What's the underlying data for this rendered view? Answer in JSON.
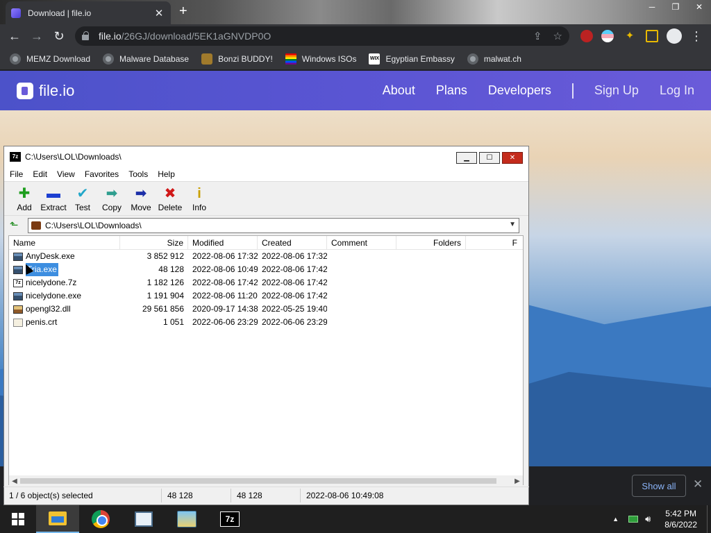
{
  "browser": {
    "tab_title": "Download | file.io",
    "url_host": "file.io",
    "url_path": "/26GJ/download/5EK1aGNVDP0O",
    "ext_badge": "1",
    "bookmarks": [
      {
        "label": "MEMZ Download",
        "icon": "globe-icon"
      },
      {
        "label": "Malware Database",
        "icon": "globe-icon"
      },
      {
        "label": "Bonzi BUDDY!",
        "icon": "bonzi-icon"
      },
      {
        "label": "Windows ISOs",
        "icon": "rainbow-flag-icon"
      },
      {
        "label": "Egyptian Embassy",
        "icon": "wix-icon"
      },
      {
        "label": "malwat.ch",
        "icon": "globe-icon"
      }
    ]
  },
  "site": {
    "logo_text": "file.io",
    "nav": [
      "About",
      "Plans",
      "Developers",
      "Sign Up",
      "Log In"
    ],
    "accent": "#5a55d3"
  },
  "download_bar": {
    "show_all": "Show all"
  },
  "sevenzip": {
    "title": "C:\\Users\\LOL\\Downloads\\",
    "menu": [
      "File",
      "Edit",
      "View",
      "Favorites",
      "Tools",
      "Help"
    ],
    "tools": [
      {
        "label": "Add",
        "glyph": "✚",
        "color": "#1e9e1e"
      },
      {
        "label": "Extract",
        "glyph": "▬",
        "color": "#1c3fd1"
      },
      {
        "label": "Test",
        "glyph": "✔",
        "color": "#22a7c9"
      },
      {
        "label": "Copy",
        "glyph": "➡",
        "color": "#2f9e8f"
      },
      {
        "label": "Move",
        "glyph": "➡",
        "color": "#1c2fa8"
      },
      {
        "label": "Delete",
        "glyph": "✖",
        "color": "#d01818"
      },
      {
        "label": "Info",
        "glyph": "i",
        "color": "#c8a000"
      }
    ],
    "address": "C:\\Users\\LOL\\Downloads\\",
    "columns": [
      "Name",
      "Size",
      "Modified",
      "Created",
      "Comment",
      "Folders",
      "F"
    ],
    "files": [
      {
        "name": "AnyDesk.exe",
        "size": "3 852 912",
        "modified": "2022-08-06 17:32",
        "created": "2022-08-06 17:32",
        "type": "exe"
      },
      {
        "name": "Tria.exe",
        "size": "48 128",
        "modified": "2022-08-06 10:49",
        "created": "2022-08-06 17:42",
        "type": "exe",
        "selected": true
      },
      {
        "name": "nicelydone.7z",
        "size": "1 182 126",
        "modified": "2022-08-06 17:42",
        "created": "2022-08-06 17:42",
        "type": "z7"
      },
      {
        "name": "nicelydone.exe",
        "size": "1 191 904",
        "modified": "2022-08-06 11:20",
        "created": "2022-08-06 17:42",
        "type": "exe"
      },
      {
        "name": "opengl32.dll",
        "size": "29 561 856",
        "modified": "2020-09-17 14:38",
        "created": "2022-05-25 19:40",
        "type": "dll"
      },
      {
        "name": "penis.crt",
        "size": "1 051",
        "modified": "2022-06-06 23:29",
        "created": "2022-06-06 23:29",
        "type": "crt"
      }
    ],
    "status": {
      "selected": "1 / 6 object(s) selected",
      "size": "48 128",
      "packed": "48 128",
      "date": "2022-08-06 10:49:08"
    }
  },
  "taskbar": {
    "time": "5:42 PM",
    "date": "8/6/2022"
  }
}
